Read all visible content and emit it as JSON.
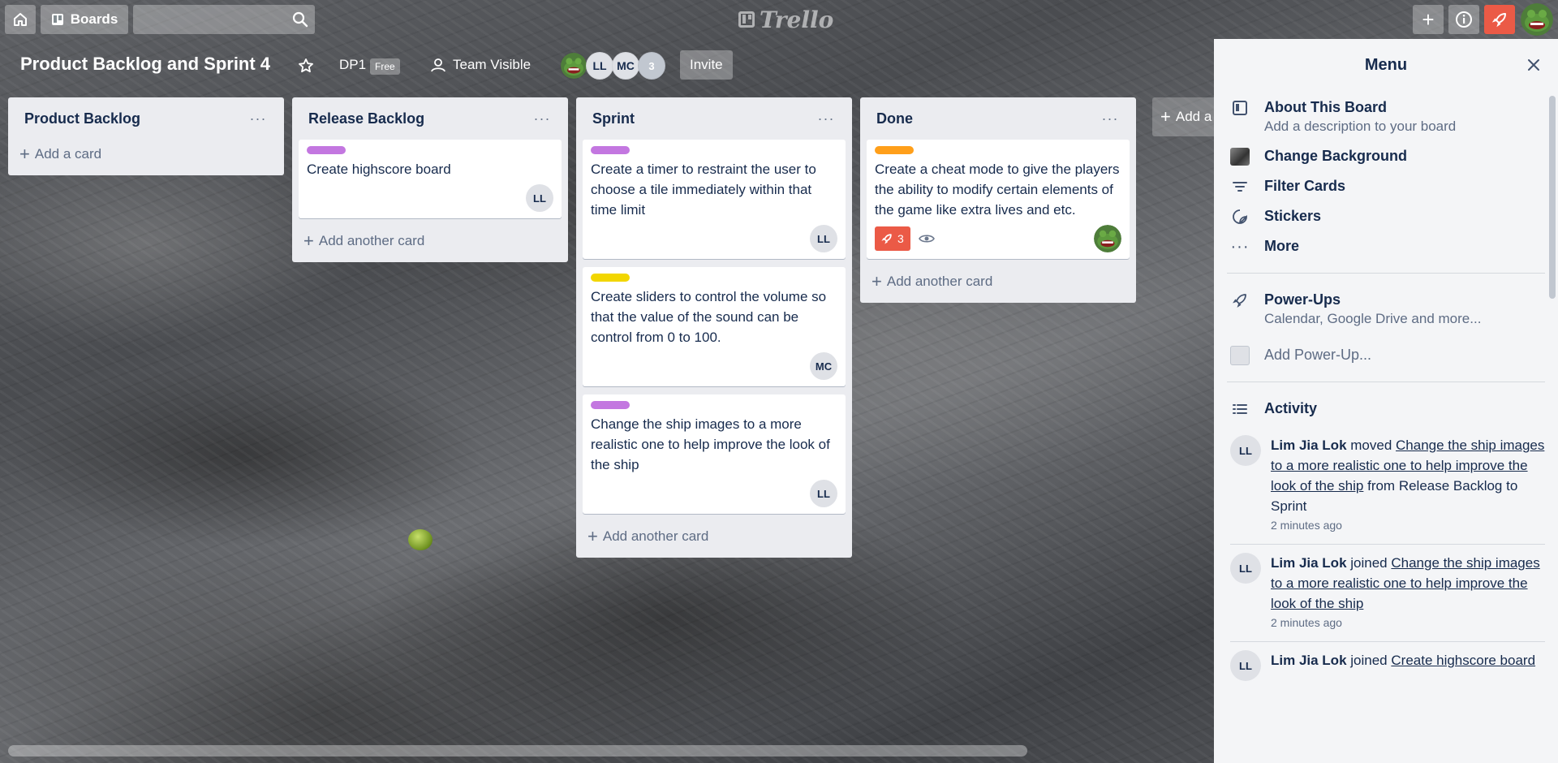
{
  "header": {
    "boards_label": "Boards",
    "search_placeholder": "",
    "logo_text": "Trello"
  },
  "board": {
    "title": "Product Backlog and Sprint 4",
    "team": "DP1",
    "plan": "Free",
    "visibility": "Team Visible",
    "members": [
      "LL",
      "MC"
    ],
    "member_overflow": "3",
    "invite_label": "Invite"
  },
  "lists": [
    {
      "title": "Product Backlog",
      "add_label": "Add a card",
      "cards": []
    },
    {
      "title": "Release Backlog",
      "add_label": "Add another card",
      "cards": [
        {
          "label_color": "#c377e0",
          "text": "Create highscore board",
          "member": "LL"
        }
      ]
    },
    {
      "title": "Sprint",
      "add_label": "Add another card",
      "cards": [
        {
          "label_color": "#c377e0",
          "text": "Create a timer to restraint the user to choose a tile immediately within that time limit",
          "member": "LL"
        },
        {
          "label_color": "#f2d600",
          "text": "Create sliders to control the volume so that the value of the sound can be control from 0 to 100.",
          "member": "MC"
        },
        {
          "label_color": "#c377e0",
          "text": "Change the ship images to a more realistic one to help improve the look of the ship",
          "member": "LL"
        }
      ]
    },
    {
      "title": "Done",
      "add_label": "Add another card",
      "cards": [
        {
          "label_color": "#ff9f1a",
          "text": "Create a cheat mode to give the players the ability to modify certain elements of the game like extra lives and etc.",
          "votes": "3",
          "member": "avatar"
        }
      ]
    }
  ],
  "add_list_label": "Add a",
  "menu": {
    "title": "Menu",
    "about_title": "About This Board",
    "about_sub": "Add a description to your board",
    "change_background": "Change Background",
    "filter_cards": "Filter Cards",
    "stickers": "Stickers",
    "more": "More",
    "powerups_title": "Power-Ups",
    "powerups_sub": "Calendar, Google Drive and more...",
    "add_powerup": "Add Power-Up...",
    "activity_title": "Activity",
    "activity": [
      {
        "user": "Lim Jia Lok",
        "action": "moved",
        "target": "Change the ship images to a more realistic one to help improve the look of the ship",
        "suffix": "from Release Backlog to Sprint",
        "time": "2 minutes ago",
        "initials": "LL"
      },
      {
        "user": "Lim Jia Lok",
        "action": "joined",
        "target": "Change the ship images to a more realistic one to help improve the look of the ship",
        "suffix": "",
        "time": "2 minutes ago",
        "initials": "LL"
      },
      {
        "user": "Lim Jia Lok",
        "action": "joined",
        "target": "Create highscore board",
        "suffix": "",
        "time": "",
        "initials": "LL"
      }
    ]
  },
  "colors": {
    "vote_badge": "#eb5a46",
    "list_bg": "#ebecf0",
    "menu_bg": "#f4f5f7"
  }
}
